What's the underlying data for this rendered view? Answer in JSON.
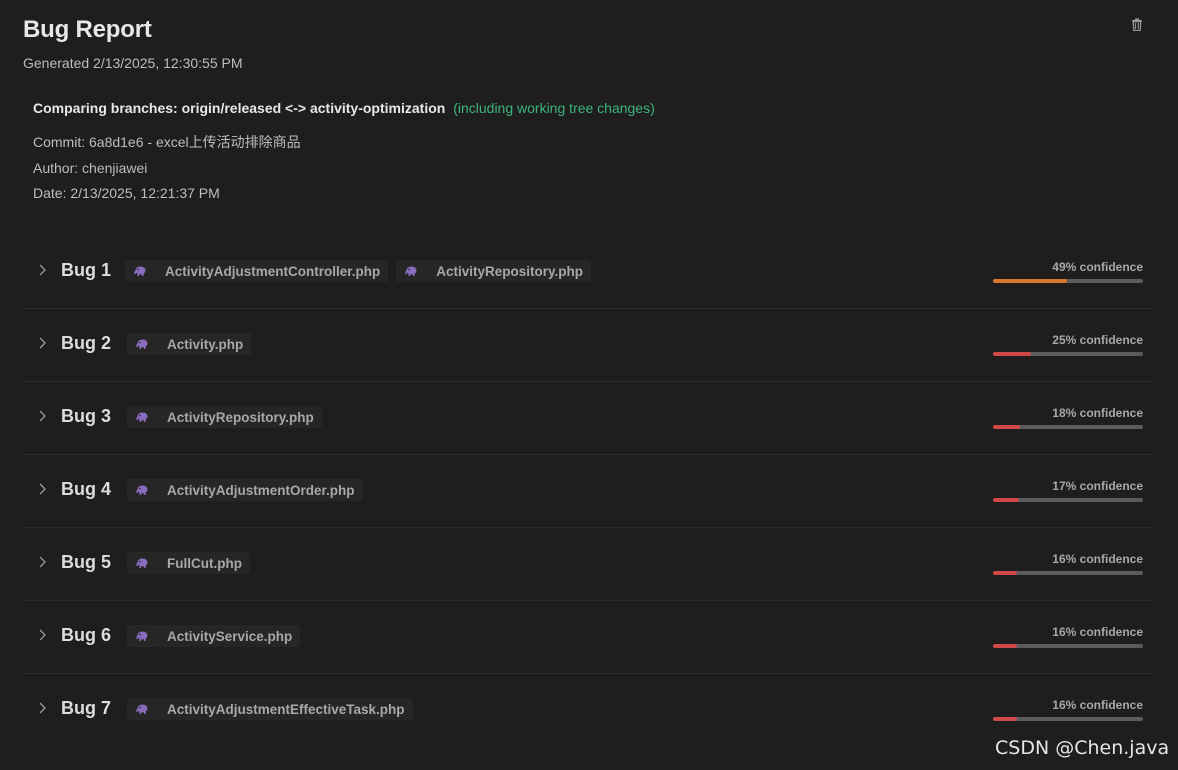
{
  "header": {
    "title": "Bug Report",
    "generated": "Generated 2/13/2025, 12:30:55 PM"
  },
  "info": {
    "branches": "Comparing branches: origin/released <-> activity-optimization",
    "working_tree": "(including working tree changes)",
    "commit": "Commit: 6a8d1e6 - excel上传活动排除商品",
    "author": "Author: chenjiawei",
    "date": "Date: 2/13/2025, 12:21:37 PM"
  },
  "colors": {
    "accent_green": "#3fb47d",
    "confidence_orange": "#d9782d",
    "confidence_red": "#d04848",
    "php_icon": "#8a6bbd"
  },
  "bugs": [
    {
      "label": "Bug 1",
      "files": [
        "ActivityAdjustmentController.php",
        "ActivityRepository.php"
      ],
      "confidence_text": "49% confidence",
      "confidence": 0.49,
      "color": "#d9782d"
    },
    {
      "label": "Bug 2",
      "files": [
        "Activity.php"
      ],
      "confidence_text": "25% confidence",
      "confidence": 0.25,
      "color": "#d04848"
    },
    {
      "label": "Bug 3",
      "files": [
        "ActivityRepository.php"
      ],
      "confidence_text": "18% confidence",
      "confidence": 0.18,
      "color": "#d04848"
    },
    {
      "label": "Bug 4",
      "files": [
        "ActivityAdjustmentOrder.php"
      ],
      "confidence_text": "17% confidence",
      "confidence": 0.17,
      "color": "#d04848"
    },
    {
      "label": "Bug 5",
      "files": [
        "FullCut.php"
      ],
      "confidence_text": "16% confidence",
      "confidence": 0.16,
      "color": "#d04848"
    },
    {
      "label": "Bug 6",
      "files": [
        "ActivityService.php"
      ],
      "confidence_text": "16% confidence",
      "confidence": 0.16,
      "color": "#d04848"
    },
    {
      "label": "Bug 7",
      "files": [
        "ActivityAdjustmentEffectiveTask.php"
      ],
      "confidence_text": "16% confidence",
      "confidence": 0.16,
      "color": "#d04848"
    }
  ],
  "icons": {
    "delete": "trash-icon",
    "expand": "chevron-right-icon",
    "file_type": "php-elephant-icon"
  },
  "watermark": "CSDN @Chen.java"
}
